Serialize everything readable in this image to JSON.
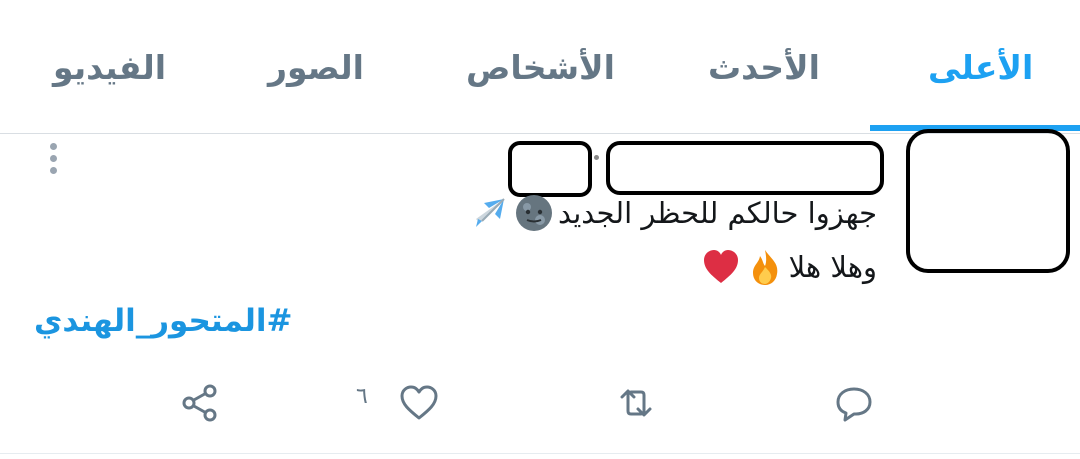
{
  "tabs": {
    "top": "الأعلى",
    "latest": "الأحدث",
    "people": "الأشخاص",
    "photos": "الصور",
    "videos": "الفيديو"
  },
  "tweet": {
    "line1": "جهزوا حالكم للحظر الجديد",
    "line2": "وهلا هلا",
    "hashtag": "#المتحور_الهندي",
    "like_count": "٦",
    "emojis_line1": [
      "full-moon-face-emoji",
      "airplane-emoji"
    ],
    "emojis_line2": [
      "fire-emoji",
      "red-heart-emoji"
    ]
  },
  "colors": {
    "accent": "#1da1f2",
    "hashtag": "#1b95e0",
    "muted": "#657786",
    "text": "#14171a"
  }
}
